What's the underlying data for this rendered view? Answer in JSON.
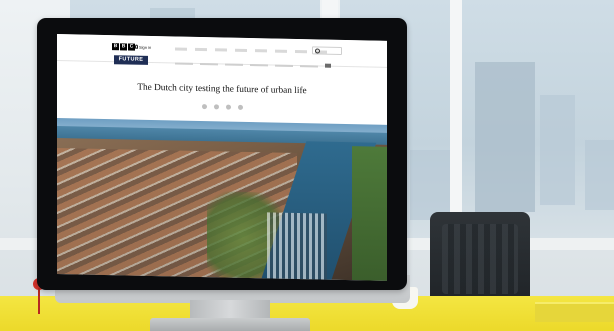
{
  "browser_page": {
    "brand": {
      "blocks": [
        "B",
        "B",
        "C"
      ],
      "signin_label": "Sign in"
    },
    "section_badge": "FUTURE",
    "nav_items": [
      "",
      "",
      "",
      "",
      "",
      "",
      "",
      ""
    ],
    "article": {
      "category": "",
      "headline": "The Dutch city testing the future of urban life"
    }
  },
  "colors": {
    "future_badge_bg": "#1f2e55",
    "desk_yellow": "#ecd92a"
  }
}
